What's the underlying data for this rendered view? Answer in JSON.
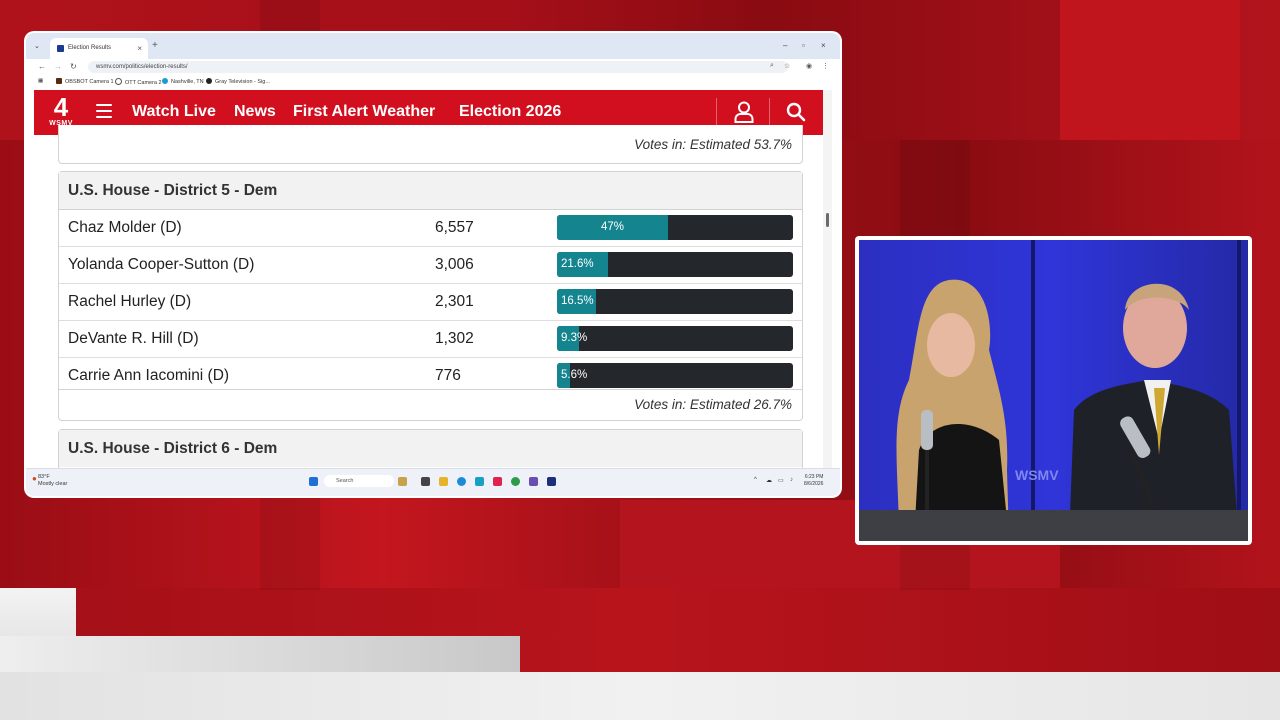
{
  "browser": {
    "tab_title": "Election Results",
    "tab_close": "×",
    "new_tab": "+",
    "url": "wsmv.com/politics/election-results/",
    "bookmarks": [
      "OBSBOT Camera 1",
      "OTT Camera 2",
      "Nashville, TN",
      "Gray Television - Sig..."
    ]
  },
  "site": {
    "logo_number": "4",
    "logo_call": "WSMV",
    "nav": [
      "Watch Live",
      "News",
      "First Alert Weather",
      "Election 2026"
    ]
  },
  "results": {
    "prev_footer": "Votes in: Estimated 53.7%",
    "races": [
      {
        "title": "U.S. House - District 5 - Dem",
        "candidates": [
          {
            "name": "Chaz Molder (D)",
            "votes": "6,557",
            "pct_label": "47%",
            "pct": 47
          },
          {
            "name": "Yolanda Cooper-Sutton (D)",
            "votes": "3,006",
            "pct_label": "21.6%",
            "pct": 21.6
          },
          {
            "name": "Rachel Hurley (D)",
            "votes": "2,301",
            "pct_label": "16.5%",
            "pct": 16.5
          },
          {
            "name": "DeVante R. Hill (D)",
            "votes": "1,302",
            "pct_label": "9.3%",
            "pct": 9.3
          },
          {
            "name": "Carrie Ann Iacomini (D)",
            "votes": "776",
            "pct_label": "5.6%",
            "pct": 5.6
          }
        ],
        "footer": "Votes in: Estimated 26.7%"
      },
      {
        "title": "U.S. House - District 6 - Dem"
      }
    ],
    "fill_color": "#14858f",
    "bar_bg_color": "#24272b"
  },
  "taskbar": {
    "weather_temp": "83°F",
    "weather_desc": "Mostly clear",
    "search_placeholder": "Search",
    "time": "6:23 PM",
    "date": "8/6/2026"
  },
  "video": {
    "station_text": "WSMV"
  },
  "colors": {
    "brand_red": "#d20f1f",
    "studio_blue": "#2a2fb8"
  }
}
